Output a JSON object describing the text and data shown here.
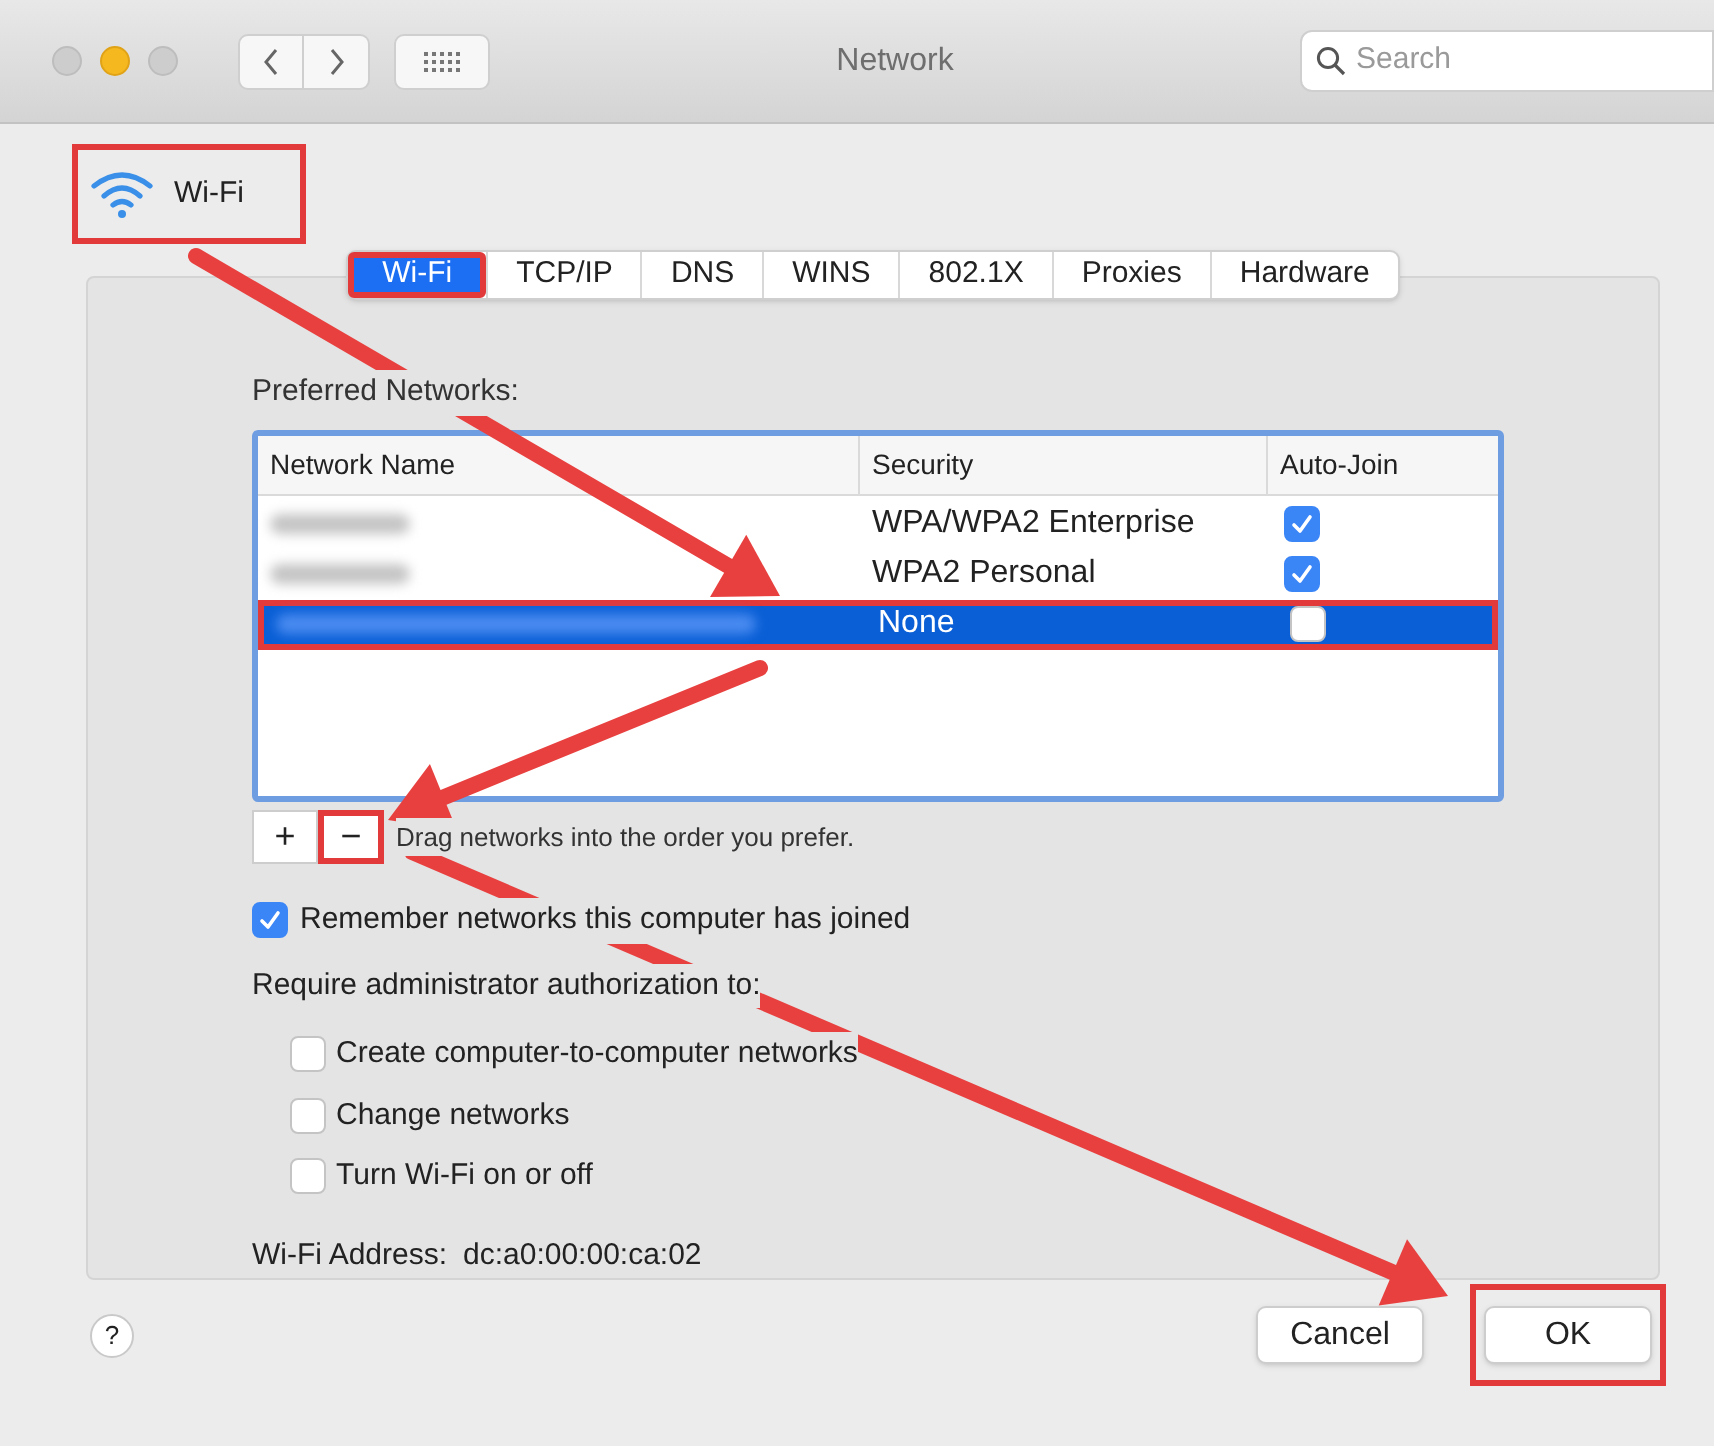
{
  "window": {
    "title": "Network",
    "search": {
      "placeholder": "Search"
    }
  },
  "header": {
    "label": "Wi-Fi",
    "highlighted": true
  },
  "tabs": [
    {
      "label": "Wi-Fi",
      "selected": true,
      "highlighted": true
    },
    {
      "label": "TCP/IP",
      "selected": false,
      "highlighted": false
    },
    {
      "label": "DNS",
      "selected": false,
      "highlighted": false
    },
    {
      "label": "WINS",
      "selected": false,
      "highlighted": false
    },
    {
      "label": "802.1X",
      "selected": false,
      "highlighted": false
    },
    {
      "label": "Proxies",
      "selected": false,
      "highlighted": false
    },
    {
      "label": "Hardware",
      "selected": false,
      "highlighted": false
    }
  ],
  "preferred_networks": {
    "label": "Preferred Networks:",
    "columns": [
      "Network Name",
      "Security",
      "Auto-Join"
    ],
    "rows": [
      {
        "security": "WPA/WPA2 Enterprise",
        "auto_join": true,
        "selected": false,
        "highlighted": false
      },
      {
        "security": "WPA2 Personal",
        "auto_join": true,
        "selected": false,
        "highlighted": false
      },
      {
        "security": "None",
        "auto_join": false,
        "selected": true,
        "highlighted": true
      }
    ]
  },
  "list_buttons": [
    {
      "label": "+",
      "highlighted": false
    },
    {
      "label": "−",
      "highlighted": true
    }
  ],
  "list_hint": "Drag networks into the order you prefer.",
  "remember": {
    "label": "Remember networks this computer has joined",
    "checked": true
  },
  "require_label": "Require administrator authorization to:",
  "admin_options": [
    {
      "label": "Create computer-to-computer networks",
      "checked": false
    },
    {
      "label": "Change networks",
      "checked": false
    },
    {
      "label": "Turn Wi-Fi on or off",
      "checked": false
    }
  ],
  "address": {
    "label": "Wi-Fi Address:",
    "value": "dc:a0:00:00:ca:02"
  },
  "help": "?",
  "buttons": [
    {
      "label": "Cancel",
      "highlighted": false
    },
    {
      "label": "OK",
      "highlighted": true
    }
  ]
}
